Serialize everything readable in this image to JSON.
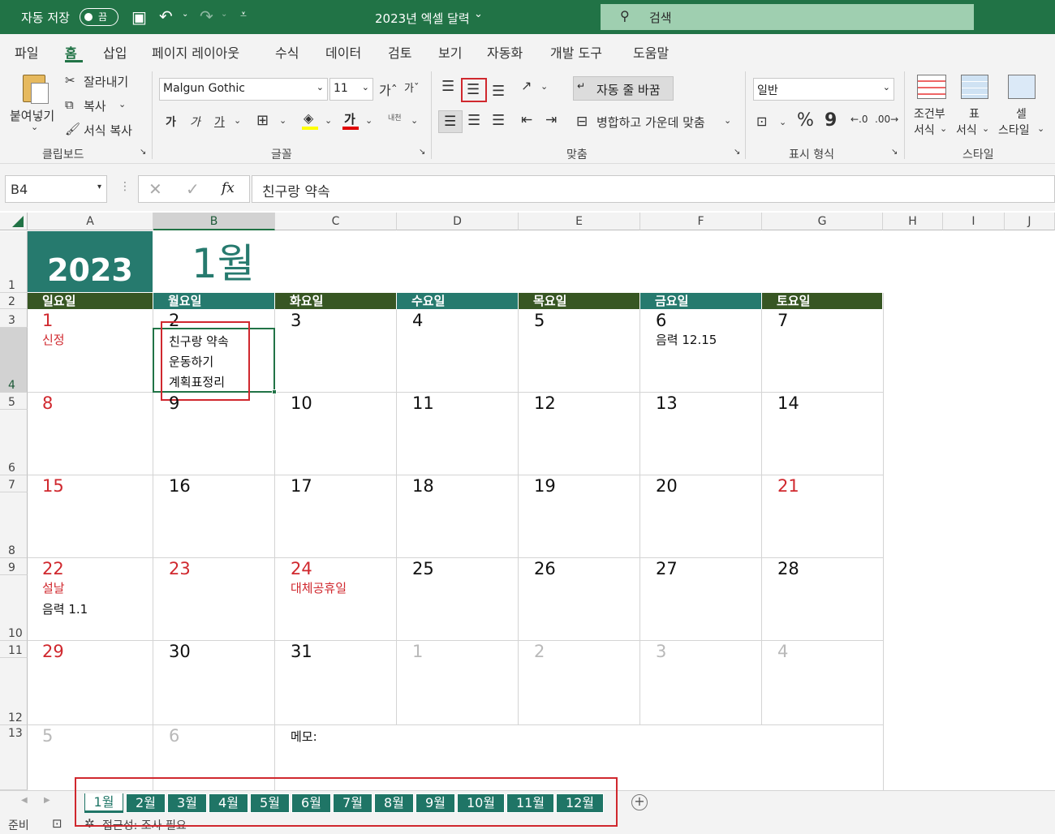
{
  "titlebar": {
    "autosave_label": "자동 저장",
    "autosave_state": "끔",
    "doc_title": "2023년 엑셀 달력",
    "search_placeholder": "검색"
  },
  "menu": [
    "파일",
    "홈",
    "삽입",
    "페이지 레이아웃",
    "수식",
    "데이터",
    "검토",
    "보기",
    "자동화",
    "개발 도구",
    "도움말"
  ],
  "ribbon": {
    "clipboard": {
      "paste": "붙여넣기",
      "cut": "잘라내기",
      "copy": "복사",
      "format_painter": "서식 복사",
      "group": "클립보드"
    },
    "font": {
      "name": "Malgun Gothic",
      "size": "11",
      "bold": "가",
      "italic": "가",
      "underline": "가",
      "font_color": "가",
      "phonetic": "내천",
      "group": "글꼴"
    },
    "alignment": {
      "wrap_text": "자동 줄 바꿈",
      "merge_center": "병합하고 가운데 맞춤",
      "group": "맞춤"
    },
    "number": {
      "format": "일반",
      "percent": "%",
      "comma": "9",
      "group": "표시 형식"
    },
    "styles": {
      "conditional": "조건부\n서식",
      "conditional_l1": "조건부",
      "conditional_l2": "서식",
      "table_l1": "표",
      "table_l2": "서식",
      "cell_l1": "셀",
      "cell_l2": "스타일",
      "group": "스타일"
    }
  },
  "formula_bar": {
    "name_box": "B4",
    "formula": "친구랑 약속",
    "fx": "fx"
  },
  "columns": [
    "A",
    "B",
    "C",
    "D",
    "E",
    "F",
    "G",
    "H",
    "I",
    "J"
  ],
  "rows": [
    "1",
    "2",
    "3",
    "4",
    "5",
    "6",
    "7",
    "8",
    "9",
    "10",
    "11",
    "12",
    "13"
  ],
  "calendar": {
    "year": "2023",
    "month": "1월",
    "weekdays": [
      "일요일",
      "월요일",
      "화요일",
      "수요일",
      "목요일",
      "금요일",
      "토요일"
    ],
    "weeks": [
      [
        "1",
        "2",
        "3",
        "4",
        "5",
        "6",
        "7"
      ],
      [
        "8",
        "9",
        "10",
        "11",
        "12",
        "13",
        "14"
      ],
      [
        "15",
        "16",
        "17",
        "18",
        "19",
        "20",
        "21"
      ],
      [
        "22",
        "23",
        "24",
        "25",
        "26",
        "27",
        "28"
      ],
      [
        "29",
        "30",
        "31",
        "1",
        "2",
        "3",
        "4"
      ],
      [
        "5",
        "6"
      ]
    ],
    "notes": {
      "jan1": "신정",
      "jan2_1": "친구랑 약속",
      "jan2_2": "운동하기",
      "jan2_3": "계획표정리",
      "jan6": "음력 12.15",
      "jan22_1": "설날",
      "jan22_2": "음력 1.1",
      "jan24": "대체공휴일"
    },
    "memo_label": "메모:"
  },
  "sheet_tabs": [
    "1월",
    "2월",
    "3월",
    "4월",
    "5월",
    "6월",
    "7월",
    "8월",
    "9월",
    "10월",
    "11월",
    "12월"
  ],
  "status": {
    "ready": "준비",
    "accessibility": "접근성: 조사 필요"
  },
  "colors": {
    "excel_green": "#217346",
    "teal": "#267a6e",
    "olive": "#375623",
    "red": "#d0282e"
  }
}
